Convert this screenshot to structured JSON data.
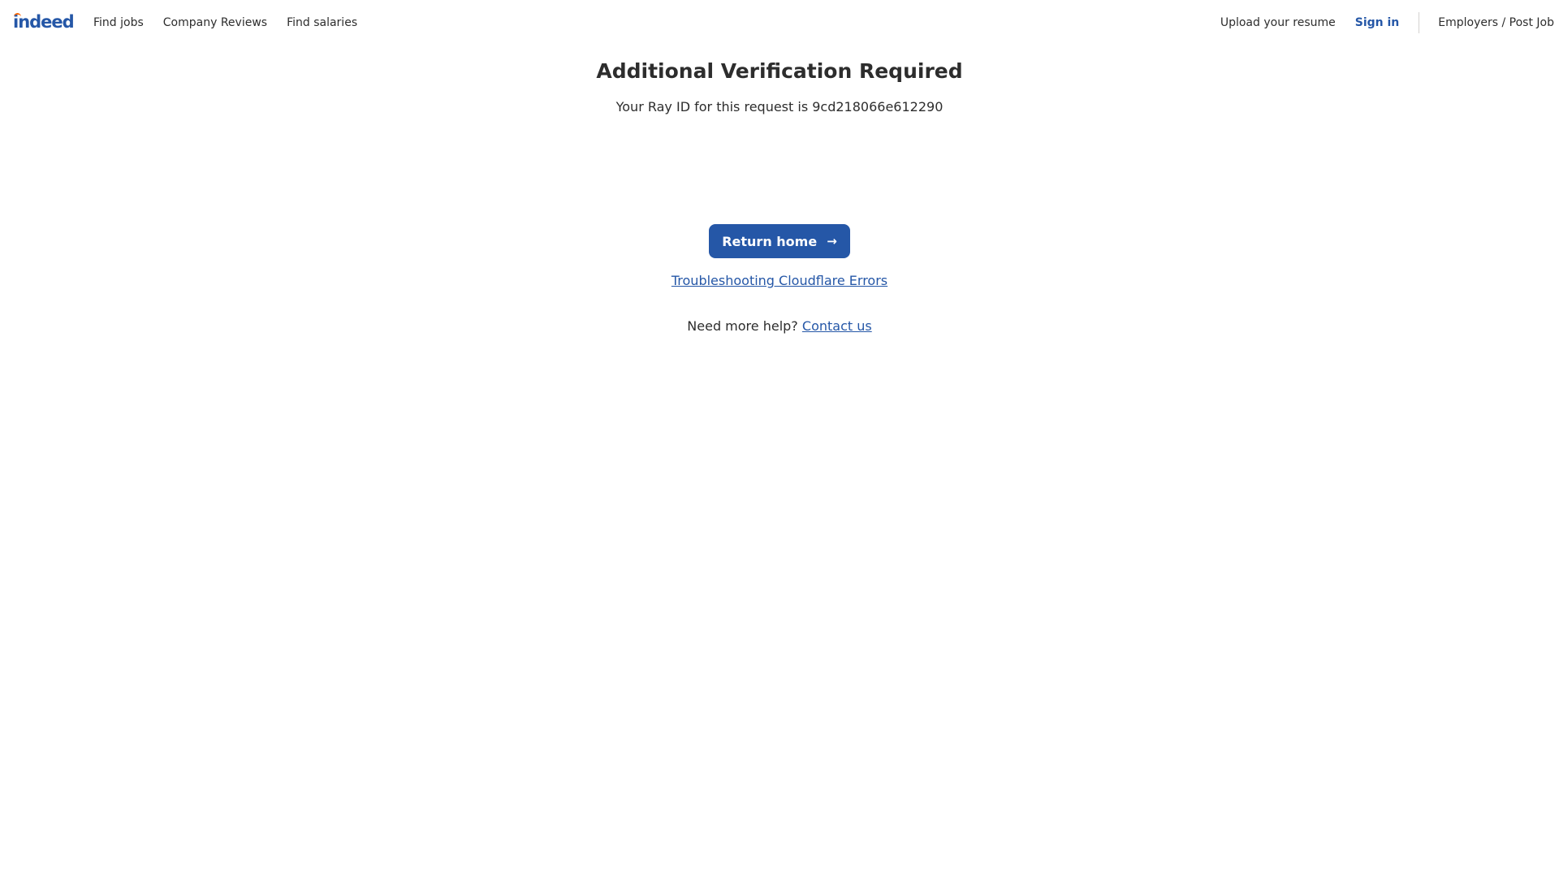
{
  "header": {
    "logo_text": "indeed",
    "nav_left": [
      {
        "label": "Find jobs"
      },
      {
        "label": "Company Reviews"
      },
      {
        "label": "Find salaries"
      }
    ],
    "upload_resume": "Upload your resume",
    "sign_in": "Sign in",
    "employers": "Employers / Post Job"
  },
  "main": {
    "title": "Additional Verification Required",
    "ray_text": "Your Ray ID for this request is 9cd218066e612290",
    "return_home_label": "Return home",
    "return_home_icon": "arrow-right-icon",
    "troubleshoot_link": "Troubleshooting Cloudflare Errors",
    "help_prefix": "Need more help?",
    "contact_link": "Contact us"
  },
  "colors": {
    "brand_blue": "#2557a7",
    "text": "#2d2d2d",
    "logo_accent": "#ff6600"
  }
}
